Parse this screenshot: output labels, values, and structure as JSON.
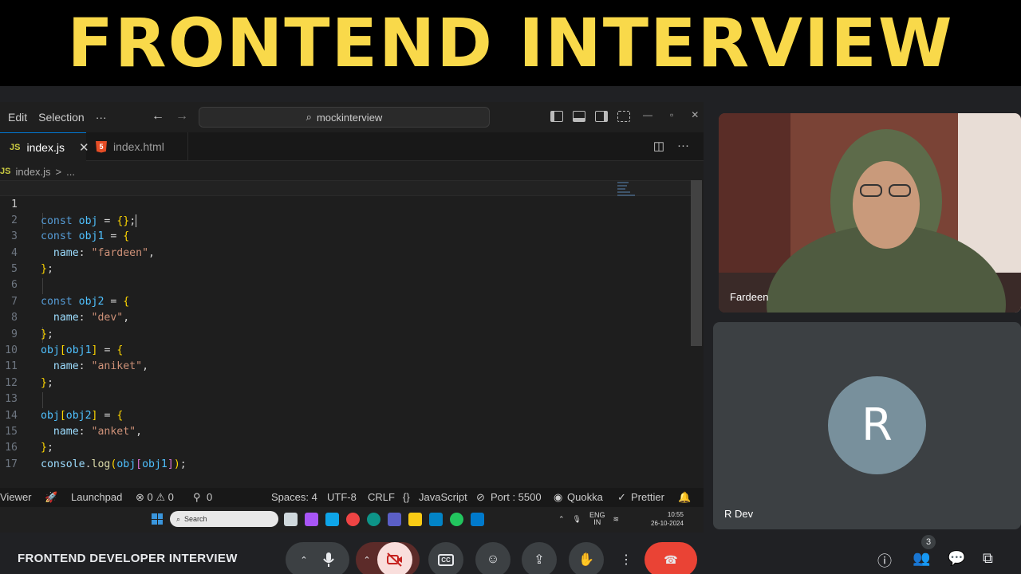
{
  "banner": {
    "title": "FRONTEND INTERVIEW"
  },
  "vscode": {
    "menu": [
      "Edit",
      "Selection",
      "···"
    ],
    "search_text": "mockinterview",
    "tabs": [
      {
        "label": "index.js",
        "badge": "JS",
        "active": true
      },
      {
        "label": "index.html",
        "badge": "5",
        "active": false
      }
    ],
    "breadcrumb": {
      "badge": "JS",
      "file": "index.js",
      "sep": ">",
      "more": "..."
    },
    "code_lines": [
      {
        "num": "1"
      },
      {
        "num": "2"
      },
      {
        "num": "3"
      },
      {
        "num": "4"
      },
      {
        "num": "5"
      },
      {
        "num": "6"
      },
      {
        "num": "7"
      },
      {
        "num": "8"
      },
      {
        "num": "9"
      },
      {
        "num": "10"
      },
      {
        "num": "11"
      },
      {
        "num": "12"
      },
      {
        "num": "13"
      },
      {
        "num": "14"
      },
      {
        "num": "15"
      },
      {
        "num": "16"
      },
      {
        "num": "17"
      }
    ],
    "tokens": {
      "const": "const",
      "obj": "obj",
      "obj1": "obj1",
      "obj2": "obj2",
      "eq": " = ",
      "empty": "{}",
      "semi": ";",
      "open": "{",
      "close": "}",
      "name": "name",
      "colon": ": ",
      "comma": ",",
      "s_fardeen": "\"fardeen\"",
      "s_dev": "\"dev\"",
      "s_aniket": "\"aniket\"",
      "s_anket": "\"anket\"",
      "console": "console",
      "log": "log",
      "dot": ".",
      "lparen": "(",
      "rparen": ")",
      "lbrack": "[",
      "rbrack": "]"
    },
    "status": {
      "viewer": "Viewer",
      "launchpad": "Launchpad",
      "problems": "⊗ 0 ⚠ 0",
      "ports": "0",
      "spaces": "Spaces: 4",
      "encoding": "UTF-8",
      "eol": "CRLF",
      "language": "JavaScript",
      "port": "Port : 5500",
      "quokka": "Quokka",
      "prettier": "Prettier"
    },
    "taskbar": {
      "search_placeholder": "Search",
      "lang": "ENG",
      "region": "IN",
      "time": "10:55",
      "date": "26-10-2024"
    }
  },
  "participants": [
    {
      "name": "Fardeen"
    },
    {
      "name": "R Dev",
      "initial": "R"
    }
  ],
  "meet": {
    "meeting_title": "FRONTEND DEVELOPER INTERVIEW",
    "people_count": "3",
    "colors": {
      "end_call": "#ea4335",
      "cam_off_bg": "#f9dedc",
      "banner_text": "#f9d94a"
    }
  }
}
